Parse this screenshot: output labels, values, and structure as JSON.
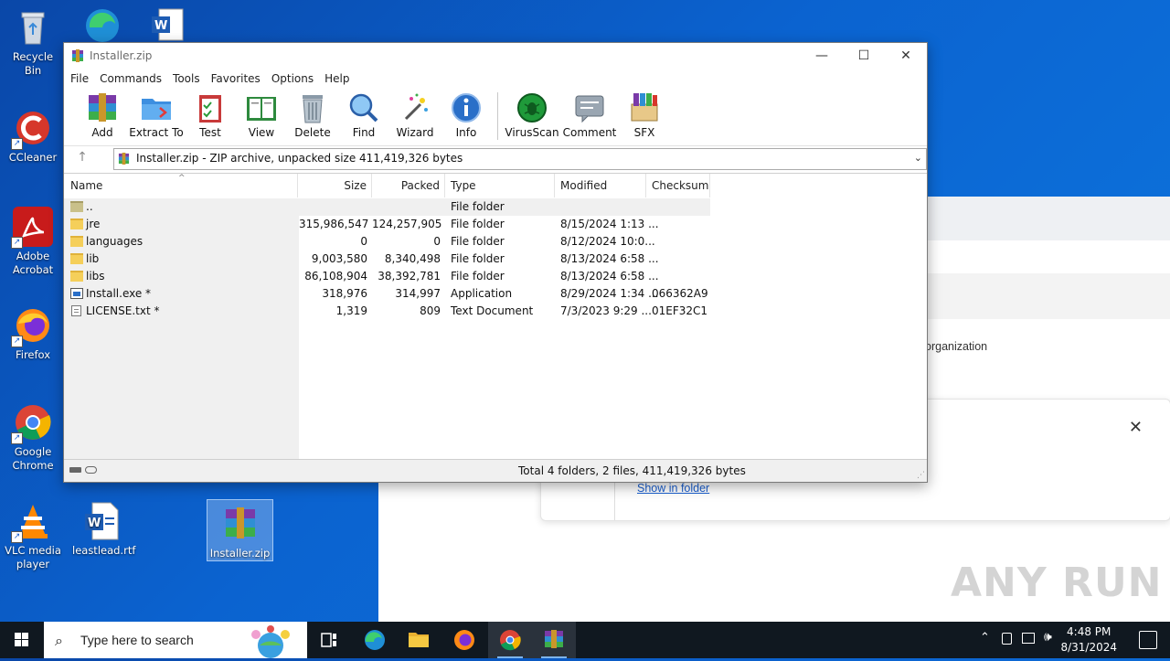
{
  "desktop": {
    "icons": [
      {
        "label": "Recycle Bin"
      },
      {
        "label": "CCleaner"
      },
      {
        "label": "Adobe\nAcrobat"
      },
      {
        "label": "Firefox"
      },
      {
        "label": "Google\nChrome"
      },
      {
        "label": "VLC media\nplayer"
      },
      {
        "label": "leastlead.rtf"
      },
      {
        "label": "Installer.zip"
      }
    ]
  },
  "background_browser": {
    "org_text": "organization",
    "show_in_folder": "Show in folder"
  },
  "winrar": {
    "title": "Installer.zip",
    "menu": [
      "File",
      "Commands",
      "Tools",
      "Favorites",
      "Options",
      "Help"
    ],
    "toolbar": [
      "Add",
      "Extract To",
      "Test",
      "View",
      "Delete",
      "Find",
      "Wizard",
      "Info",
      "VirusScan",
      "Comment",
      "SFX"
    ],
    "address": "Installer.zip - ZIP archive, unpacked size 411,419,326 bytes",
    "columns": [
      "Name",
      "Size",
      "Packed",
      "Type",
      "Modified",
      "Checksum"
    ],
    "rows": [
      {
        "name": "..",
        "size": "",
        "packed": "",
        "type": "File folder",
        "modified": "",
        "checksum": "",
        "icon": "folder-up"
      },
      {
        "name": "jre",
        "size": "315,986,547",
        "packed": "124,257,905",
        "type": "File folder",
        "modified": "8/15/2024 1:13 ...",
        "checksum": "",
        "icon": "folder"
      },
      {
        "name": "languages",
        "size": "0",
        "packed": "0",
        "type": "File folder",
        "modified": "8/12/2024 10:0...",
        "checksum": "",
        "icon": "folder"
      },
      {
        "name": "lib",
        "size": "9,003,580",
        "packed": "8,340,498",
        "type": "File folder",
        "modified": "8/13/2024 6:58 ...",
        "checksum": "",
        "icon": "folder"
      },
      {
        "name": "libs",
        "size": "86,108,904",
        "packed": "38,392,781",
        "type": "File folder",
        "modified": "8/13/2024 6:58 ...",
        "checksum": "",
        "icon": "folder"
      },
      {
        "name": "Install.exe *",
        "size": "318,976",
        "packed": "314,997",
        "type": "Application",
        "modified": "8/29/2024 1:34 ...",
        "checksum": "066362A9",
        "icon": "exe"
      },
      {
        "name": "LICENSE.txt *",
        "size": "1,319",
        "packed": "809",
        "type": "Text Document",
        "modified": "7/3/2023 9:29 ...",
        "checksum": "01EF32C1",
        "icon": "txt"
      }
    ],
    "status": "Total 4 folders, 2 files, 411,419,326 bytes"
  },
  "taskbar": {
    "search_placeholder": "Type here to search",
    "time": "4:48 PM",
    "date": "8/31/2024"
  },
  "watermark": "ANY RUN",
  "colors": {
    "desktop": "#0b63d0",
    "taskbar": "#101820",
    "accent": "#1a5fd0"
  }
}
